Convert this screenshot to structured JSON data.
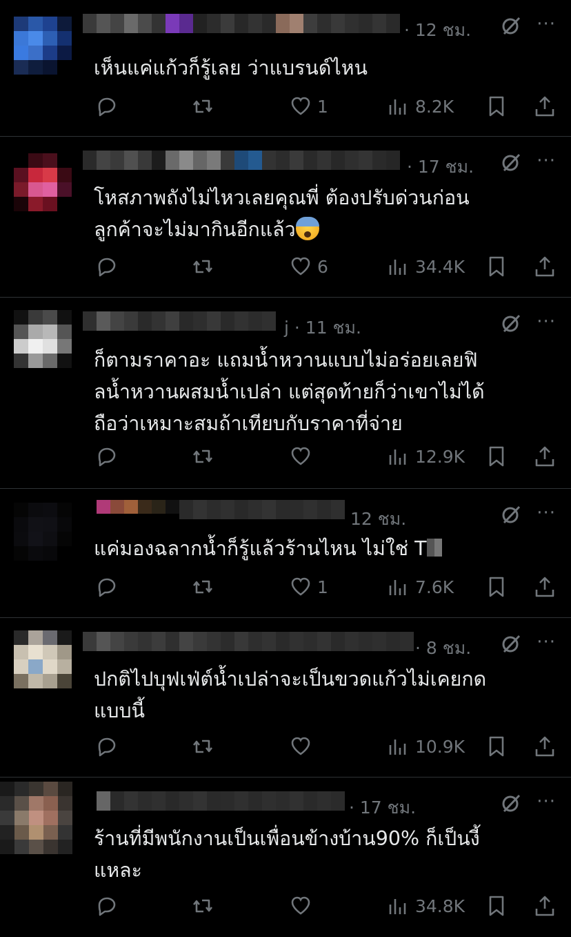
{
  "posts": [
    {
      "time": "· 12 ชม.",
      "lines": [
        "เห็นแค่แก้วก็รู้เลย ว่าแบรนด์ไหน"
      ],
      "likes": "1",
      "views": "8.2K"
    },
    {
      "time": "· 17 ชม.",
      "lines": [
        "โหสภาพถังไม่ไหวเลยคุณพี่ ต้องปรับด่วนก่อน",
        "ลูกค้าจะไม่มากินอีกแล้ว"
      ],
      "emoji": "anxious-face-emoji",
      "likes": "6",
      "views": "34.4K"
    },
    {
      "time": "j · 11 ชม.",
      "lines": [
        "ก็ตามราคาอะ แถมน้ำหวานแบบไม่อร่อยเลยฟิ",
        "ลน้ำหวานผสมน้ำเปล่า แต่สุดท้ายก็ว่าเขาไม่ได้",
        "ถือว่าเหมาะสมถ้าเทียบกับราคาที่จ่าย"
      ],
      "likes": "",
      "views": "12.9K"
    },
    {
      "time": "12 ชม.",
      "lines": [
        "แค่มองฉลากน้ำก็รู้แล้วร้านไหน ไม่ใช่ T"
      ],
      "likes": "1",
      "views": "7.6K"
    },
    {
      "time": "· 8 ชม.",
      "lines": [
        "ปกติไปบุฟเฟ่ต์น้ำเปล่าจะเป็นขวดแก้วไม่เคยกด",
        "แบบนี้"
      ],
      "likes": "",
      "views": "10.9K"
    },
    {
      "time": "· 17 ชม.",
      "lines": [
        "ร้านที่มีพนักงานเป็นเพื่อนข้างบ้าน90% ก็เป็นงี้",
        "แหละ"
      ],
      "likes": "",
      "views": "34.8K"
    }
  ],
  "icons": {
    "reply": "reply-icon",
    "repost": "repost-icon",
    "like": "heart-icon",
    "views": "views-icon",
    "bookmark": "bookmark-icon",
    "share": "share-icon",
    "grok": "grok-icon",
    "more": "more-icon"
  },
  "more_label": "···"
}
